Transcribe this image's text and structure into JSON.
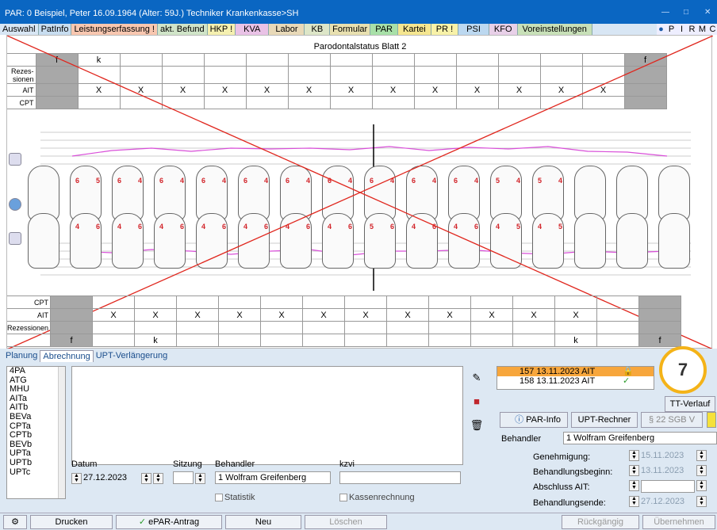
{
  "window": {
    "title": "PAR: 0  Beispiel, Peter  16.09.1964 (Alter: 59J.)  Techniker Krankenkasse>SH"
  },
  "menu": [
    "Auswahl",
    "PatInfo",
    "Leistungserfassung !",
    "akt. Befund",
    "HKP !",
    "KVA",
    "Labor",
    "KB",
    "Formular",
    "PAR",
    "Kartei",
    "PR !",
    "PSI",
    "KFO",
    "Voreinstellungen"
  ],
  "menu_right": [
    "P",
    "I",
    "R",
    "M",
    "C"
  ],
  "sheet": {
    "title": "Parodontalstatus Blatt 2",
    "upper_rows": {
      "f": "f",
      "k": "k",
      "rez": "Rezes-sionen",
      "ait": "AIT",
      "cpt": "CPT",
      "x": "X"
    },
    "lower_rows": {
      "cpt": "CPT",
      "ait": "AIT",
      "rez": "Rezessionen",
      "f": "f",
      "k": "k",
      "x": "X"
    },
    "upper_numbers": [
      "6",
      "5",
      "6",
      "4",
      "6",
      "4",
      "6",
      "4",
      "6",
      "4",
      "6",
      "4",
      "6",
      "4",
      "6",
      "4",
      "6",
      "4",
      "6",
      "4",
      "5",
      "4",
      "5",
      "4"
    ],
    "lower_numbers": [
      "4",
      "6",
      "4",
      "6",
      "4",
      "6",
      "4",
      "6",
      "4",
      "6",
      "4",
      "6",
      "4",
      "6",
      "5",
      "6",
      "4",
      "6",
      "4",
      "6",
      "4",
      "5",
      "4",
      "5"
    ]
  },
  "lower": {
    "tabs": [
      "Planung",
      "Abrechnung",
      "UPT-Verlängerung"
    ],
    "active_tab": "Abrechnung",
    "codes": [
      "4PA",
      "ATG",
      "MHU",
      "AITa",
      "AITb",
      "BEVa",
      "CPTa",
      "CPTb",
      "BEVb",
      "UPTa",
      "UPTb",
      "UPTc"
    ],
    "datum_label": "Datum",
    "datum_value": "27.12.2023",
    "sitzung_label": "Sitzung",
    "behandler_label": "Behandler",
    "behandler_value": "1 Wolfram Greifenberg",
    "kzvi_label": "kzvi",
    "statistik": "Statistik",
    "kassenrechnung": "Kassenrechnung",
    "history": [
      {
        "text": "157  13.11.2023  AIT",
        "selected": true
      },
      {
        "text": "158  13.11.2023  AIT",
        "selected": false
      }
    ],
    "badge": "7",
    "tt_verlauf": "TT-Verlauf",
    "par_info": "PAR-Info",
    "upt_rechner": "UPT-Rechner",
    "sgb": "§ 22 SGB V",
    "behandler2_label": "Behandler",
    "behandler2_value": "1 Wolfram Greifenberg",
    "dates": [
      {
        "label": "Genehmigung:",
        "value": "15.11.2023"
      },
      {
        "label": "Behandlungsbeginn:",
        "value": "13.11.2023"
      },
      {
        "label": "Abschluss AIT:",
        "value": ""
      },
      {
        "label": "Behandlungsende:",
        "value": "27.12.2023"
      }
    ]
  },
  "bottom": {
    "drucken": "Drucken",
    "epar": "ePAR-Antrag",
    "neu": "Neu",
    "loeschen": "Löschen",
    "rueckgaengig": "Rückgängig",
    "uebernehmen": "Übernehmen"
  }
}
